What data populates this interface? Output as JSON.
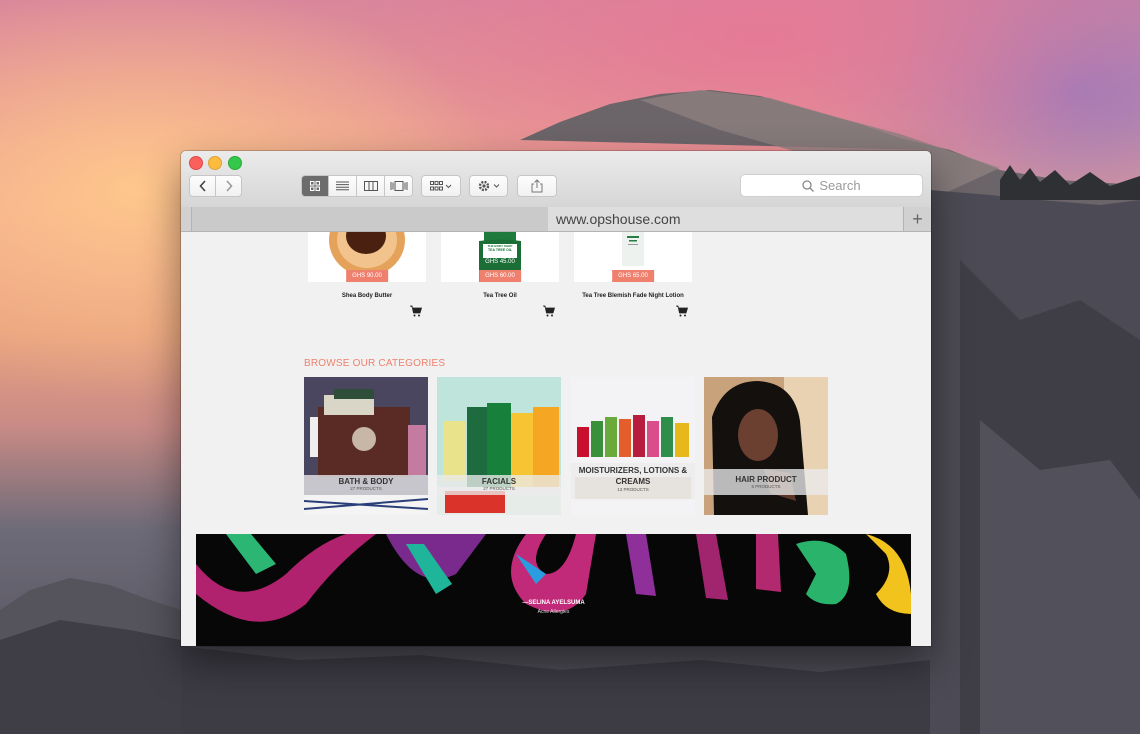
{
  "browser": {
    "url": "www.opshouse.com",
    "search_placeholder": "Search",
    "new_tab_symbol": "+"
  },
  "products": [
    {
      "name": "Shea Body Butter",
      "price": "GHS 90.00",
      "old_price": ""
    },
    {
      "name": "Tea Tree Oil",
      "price": "GHS 60.00",
      "old_price": "GHS 45.00"
    },
    {
      "name": "Tea Tree Blemish Fade Night Lotion",
      "price": "GHS 65.00",
      "old_price": ""
    }
  ],
  "product_image_text": {
    "tea_tree_brand": "THE BODY SHOP",
    "tea_tree_label": "TEA TREE OIL"
  },
  "categories_heading": "BROWSE OUR CATEGORIES",
  "categories": [
    {
      "title": "BATH & BODY",
      "count": "27 PRODUCTS"
    },
    {
      "title": "FACIALS",
      "count": "27 PRODUCTS"
    },
    {
      "title": "MOISTURIZERS, LOTIONS & CREAMS",
      "count": "13 PRODUCTS"
    },
    {
      "title": "HAIR PRODUCT",
      "count": "6 PRODUCTS"
    }
  ],
  "testimonial": {
    "author": "—SELINA AYELSUMA",
    "subtitle": "Acne Allergies"
  },
  "colors": {
    "accent": "#f0806e",
    "banner_bg": "#070707"
  },
  "icons": [
    "back-arrow-icon",
    "forward-arrow-icon",
    "grid-view-icon",
    "list-view-icon",
    "column-view-icon",
    "coverflow-view-icon",
    "arrange-icon",
    "gear-icon",
    "share-icon",
    "search-icon",
    "cart-icon"
  ]
}
